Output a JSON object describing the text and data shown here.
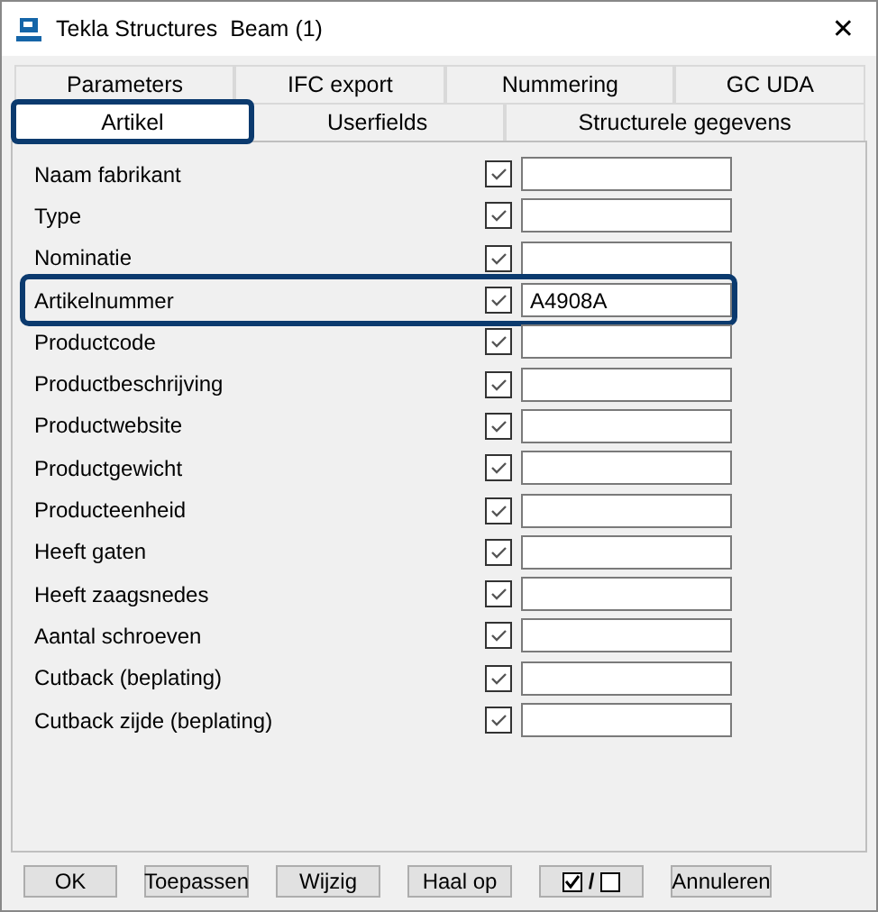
{
  "window": {
    "title": "Tekla Structures  Beam (1)",
    "close": "✕"
  },
  "tabs_back": [
    {
      "label": "Parameters",
      "selected": false
    },
    {
      "label": "IFC export",
      "selected": false
    },
    {
      "label": "Nummering",
      "selected": false
    },
    {
      "label": "GC UDA",
      "selected": false
    }
  ],
  "tabs_front": [
    {
      "label": "Artikel",
      "selected": true,
      "highlighted": true
    },
    {
      "label": "Userfields",
      "selected": false,
      "highlighted": false
    },
    {
      "label": "Structurele gegevens",
      "selected": false,
      "highlighted": false
    }
  ],
  "rows": [
    {
      "label": "Naam fabrikant",
      "checked": true,
      "value": "",
      "highlighted": false
    },
    {
      "label": "Type",
      "checked": true,
      "value": "",
      "highlighted": false
    },
    {
      "label": "Nominatie",
      "checked": true,
      "value": "",
      "highlighted": false
    },
    {
      "label": "Artikelnummer",
      "checked": true,
      "value": "A4908A",
      "highlighted": true
    },
    {
      "label": "Productcode",
      "checked": true,
      "value": "",
      "highlighted": false
    },
    {
      "label": "Productbeschrijving",
      "checked": true,
      "value": "",
      "highlighted": false
    },
    {
      "label": "Productwebsite",
      "checked": true,
      "value": "",
      "highlighted": false
    },
    {
      "label": "Productgewicht",
      "checked": true,
      "value": "",
      "highlighted": false
    },
    {
      "label": "Producteenheid",
      "checked": true,
      "value": "",
      "highlighted": false
    },
    {
      "label": "Heeft gaten",
      "checked": true,
      "value": "",
      "highlighted": false
    },
    {
      "label": "Heeft zaagsnedes",
      "checked": true,
      "value": "",
      "highlighted": false
    },
    {
      "label": "Aantal schroeven",
      "checked": true,
      "value": "",
      "highlighted": false
    },
    {
      "label": "Cutback (beplating)",
      "checked": true,
      "value": "",
      "highlighted": false
    },
    {
      "label": "Cutback zijde (beplating)",
      "checked": true,
      "value": "",
      "highlighted": false
    }
  ],
  "buttons": [
    {
      "kind": "text",
      "label": "OK"
    },
    {
      "kind": "text",
      "label": "Toepassen"
    },
    {
      "kind": "text",
      "label": "Wijzig"
    },
    {
      "kind": "text",
      "label": "Haal op"
    },
    {
      "kind": "toggle",
      "label": "/"
    },
    {
      "kind": "text",
      "label": "Annuleren"
    }
  ]
}
